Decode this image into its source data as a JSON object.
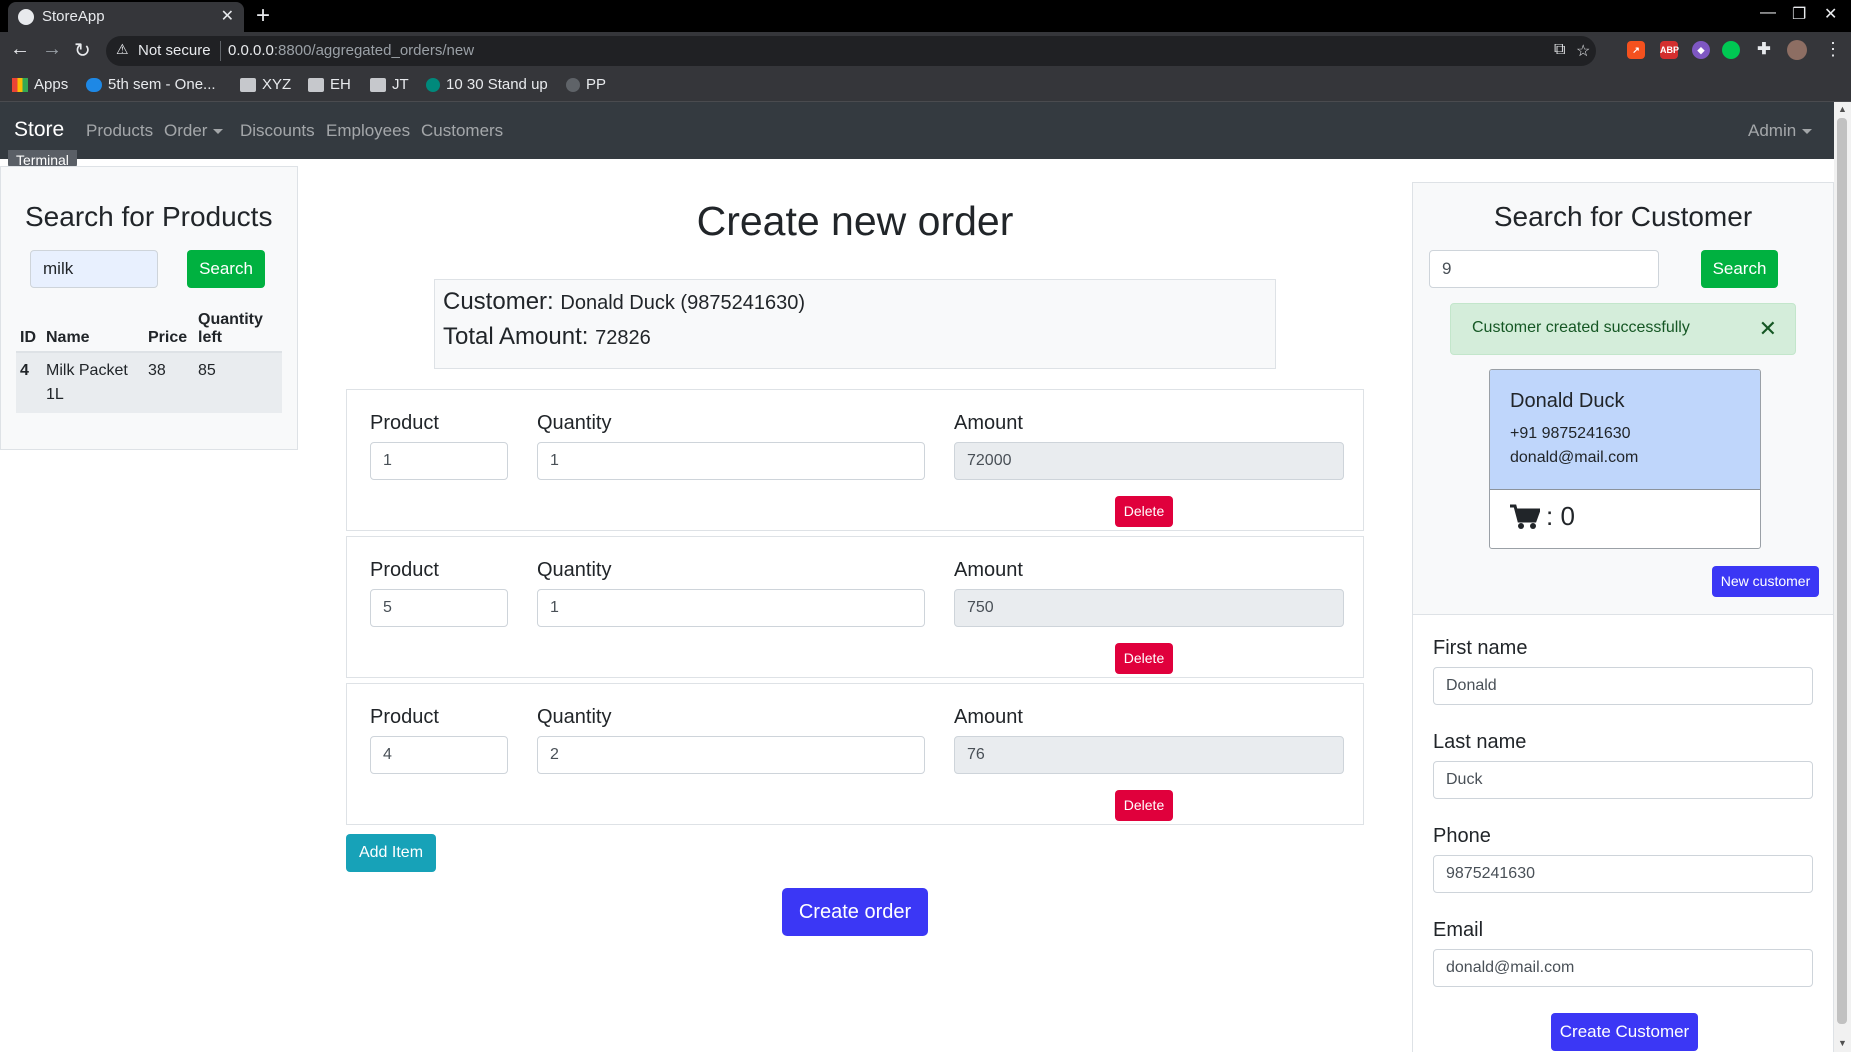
{
  "browser": {
    "tab_title": "StoreApp",
    "tab_close": "✕",
    "new_tab": "+",
    "not_secure": "Not secure",
    "url_host": "0.0.0.0",
    "url_rest": ":8800/aggregated_orders/new",
    "bookmarks": [
      "Apps",
      "5th sem - One...",
      "XYZ",
      "EH",
      "JT",
      "10 30 Stand up",
      "PP"
    ]
  },
  "navbar": {
    "brand": "Store",
    "links": [
      "Products",
      "Order",
      "Discounts",
      "Employees",
      "Customers"
    ],
    "admin": "Admin",
    "tooltip": "Terminal"
  },
  "product_search": {
    "title": "Search for Products",
    "query": "milk",
    "button": "Search",
    "columns": [
      "ID",
      "Name",
      "Price",
      "Quantity left"
    ],
    "rows": [
      {
        "id": "4",
        "name": "Milk Packet 1L",
        "price": "38",
        "quantity_left": "85"
      }
    ]
  },
  "order": {
    "title": "Create new order",
    "customer_label": "Customer:",
    "customer_value": "Donald Duck (9875241630)",
    "total_label": "Total Amount:",
    "total_value": "72826",
    "labels": {
      "product": "Product",
      "quantity": "Quantity",
      "amount": "Amount",
      "delete": "Delete"
    },
    "items": [
      {
        "product": "1",
        "quantity": "1",
        "amount": "72000"
      },
      {
        "product": "5",
        "quantity": "1",
        "amount": "750"
      },
      {
        "product": "4",
        "quantity": "2",
        "amount": "76"
      }
    ],
    "add_item": "Add Item",
    "create_order": "Create order"
  },
  "customer_search": {
    "title": "Search for Customer",
    "query": "9",
    "button": "Search",
    "alert": "Customer created successfully",
    "card": {
      "name": "Donald Duck",
      "phone": "+91 9875241630",
      "email": "donald@mail.com",
      "cart_count": ": 0"
    },
    "new_customer": "New customer"
  },
  "customer_form": {
    "first_name_label": "First name",
    "first_name": "Donald",
    "last_name_label": "Last name",
    "last_name": "Duck",
    "phone_label": "Phone",
    "phone": "9875241630",
    "email_label": "Email",
    "email": "donald@mail.com",
    "submit": "Create Customer"
  }
}
